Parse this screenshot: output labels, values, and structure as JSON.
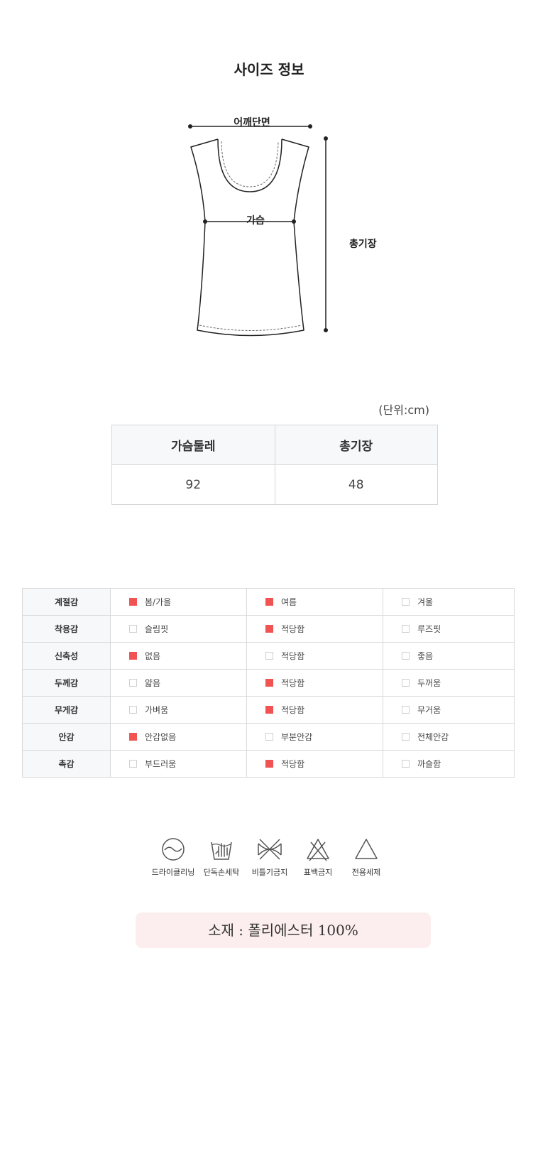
{
  "title": "사이즈 정보",
  "diagram": {
    "shoulder_label": "어깨단면",
    "chest_label": "가슴",
    "length_label": "총기장"
  },
  "unit_note": "(단위:cm)",
  "size_table": {
    "headers": [
      "가슴둘레",
      "총기장"
    ],
    "values": [
      "92",
      "48"
    ]
  },
  "attributes": [
    {
      "name": "계절감",
      "options": [
        {
          "label": "봄/가을",
          "checked": true
        },
        {
          "label": "여름",
          "checked": true
        },
        {
          "label": "겨울",
          "checked": false
        }
      ]
    },
    {
      "name": "착용감",
      "options": [
        {
          "label": "슬림핏",
          "checked": false
        },
        {
          "label": "적당함",
          "checked": true
        },
        {
          "label": "루즈핏",
          "checked": false
        }
      ]
    },
    {
      "name": "신축성",
      "options": [
        {
          "label": "없음",
          "checked": true
        },
        {
          "label": "적당함",
          "checked": false
        },
        {
          "label": "좋음",
          "checked": false
        }
      ]
    },
    {
      "name": "두께감",
      "options": [
        {
          "label": "얇음",
          "checked": false
        },
        {
          "label": "적당함",
          "checked": true
        },
        {
          "label": "두꺼움",
          "checked": false
        }
      ]
    },
    {
      "name": "무게감",
      "options": [
        {
          "label": "가벼움",
          "checked": false
        },
        {
          "label": "적당함",
          "checked": true
        },
        {
          "label": "무거움",
          "checked": false
        }
      ]
    },
    {
      "name": "안감",
      "options": [
        {
          "label": "안감없음",
          "checked": true
        },
        {
          "label": "부분안감",
          "checked": false
        },
        {
          "label": "전체안감",
          "checked": false
        }
      ]
    },
    {
      "name": "촉감",
      "options": [
        {
          "label": "부드러움",
          "checked": false
        },
        {
          "label": "적당함",
          "checked": true
        },
        {
          "label": "까슬함",
          "checked": false
        }
      ]
    }
  ],
  "care": [
    {
      "icon": "dry-clean-icon",
      "label": "드라이클리닝"
    },
    {
      "icon": "hand-wash-icon",
      "label": "단독손세탁"
    },
    {
      "icon": "no-wring-icon",
      "label": "비틀기금지"
    },
    {
      "icon": "no-bleach-icon",
      "label": "표백금지"
    },
    {
      "icon": "neutral-detergent-icon",
      "label": "전용세제"
    }
  ],
  "material": "소재 : 폴리에스터 100%",
  "colors": {
    "checked": "#f15252",
    "material_bg": "#fceeee",
    "header_bg": "#f7f8fa"
  }
}
